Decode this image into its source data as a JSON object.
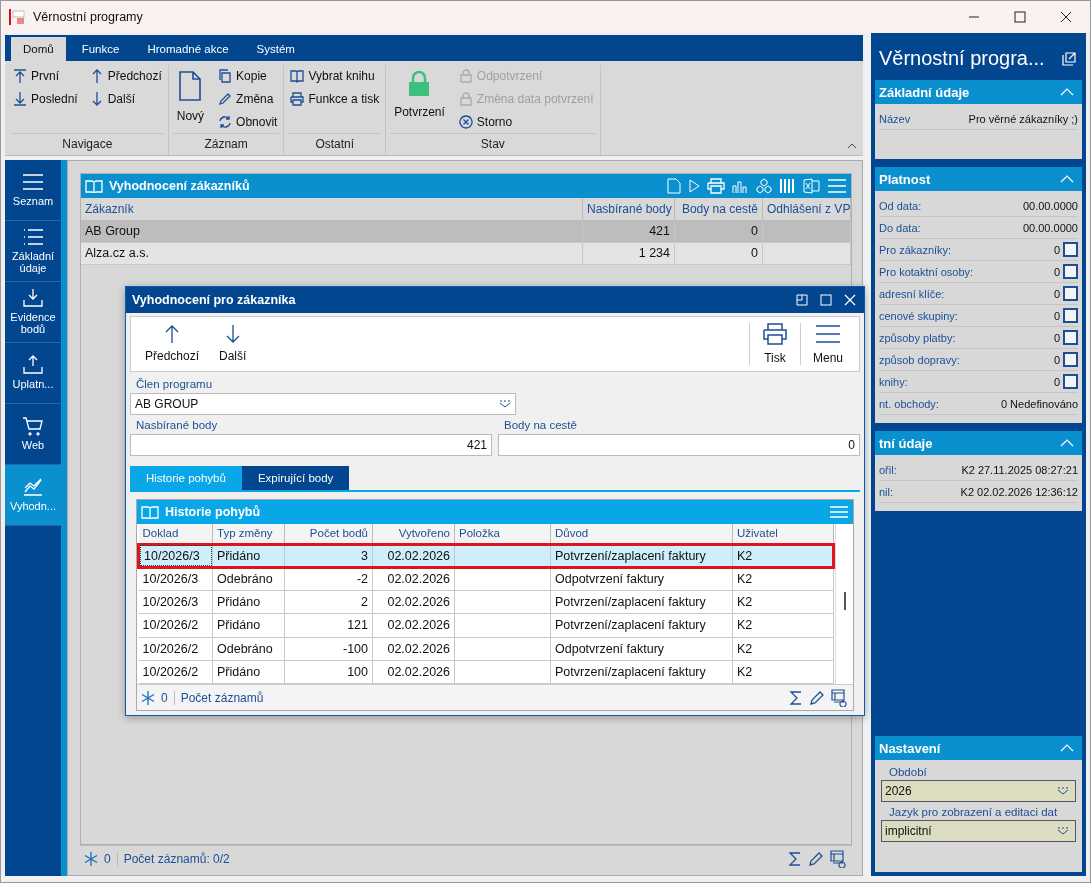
{
  "window": {
    "title": "Věrnostní programy"
  },
  "ribbon": {
    "tabs": [
      {
        "label": "Domů",
        "selected": true
      },
      {
        "label": "Funkce",
        "selected": false
      },
      {
        "label": "Hromadné akce",
        "selected": false
      },
      {
        "label": "Systém",
        "selected": false
      }
    ],
    "groups": [
      {
        "label": "Navigace",
        "columns": [
          [
            {
              "label": "První",
              "disabled": false
            },
            {
              "label": "Poslední",
              "disabled": false
            }
          ],
          [
            {
              "label": "Předchozí",
              "disabled": false
            },
            {
              "label": "Další",
              "disabled": false
            }
          ]
        ]
      },
      {
        "label": "Záznam",
        "large": {
          "label": "Nový",
          "disabled": false
        },
        "columns": [
          [
            {
              "label": "Kopie",
              "disabled": false
            },
            {
              "label": "Změna",
              "disabled": false
            },
            {
              "label": "Obnovit",
              "disabled": false
            }
          ]
        ]
      },
      {
        "label": "Ostatní",
        "columns": [
          [
            {
              "label": "Vybrat knihu",
              "disabled": false
            },
            {
              "label": "Funkce a tisk",
              "disabled": false
            }
          ]
        ]
      },
      {
        "label": "Stav",
        "large": {
          "label": "Potvrzení",
          "disabled": false
        },
        "columns": [
          [
            {
              "label": "Odpotvrzení",
              "disabled": true
            },
            {
              "label": "Změna data potvrzení",
              "disabled": true
            },
            {
              "label": "Storno",
              "disabled": false
            }
          ]
        ]
      }
    ]
  },
  "sidebar": {
    "items": [
      {
        "label": "Seznam",
        "selected": false
      },
      {
        "label": "Základní údaje",
        "selected": false
      },
      {
        "label": "Evidence bodů",
        "selected": false
      },
      {
        "label": "Uplatn...",
        "selected": false
      },
      {
        "label": "Web",
        "selected": false
      },
      {
        "label": "Vyhodn...",
        "selected": true
      }
    ]
  },
  "main_table": {
    "title": "Vyhodnocení zákazníků",
    "columns": [
      "Zákazník",
      "Nasbírané body",
      "Body na cestě",
      "Odhlášení z VP"
    ],
    "rows": [
      {
        "cells": [
          "AB Group",
          "421",
          "0",
          ""
        ],
        "selected": true
      },
      {
        "cells": [
          "Alza.cz a.s.",
          "1 234",
          "0",
          ""
        ],
        "selected": false
      }
    ],
    "footer": {
      "count": "0",
      "records": "Počet záznamů: 0/2"
    }
  },
  "dialog": {
    "title": "Vyhodnocení pro zákazníka",
    "toolbar_left": [
      "Předchozí",
      "Další"
    ],
    "toolbar_right": [
      "Tisk",
      "Menu"
    ],
    "member": {
      "label": "Člen programu",
      "value": "AB GROUP"
    },
    "collected": {
      "label": "Nasbírané body",
      "value": "421"
    },
    "pending": {
      "label": "Body na cestě",
      "value": "0"
    },
    "tabs": [
      {
        "label": "Historie pohybů",
        "selected": true
      },
      {
        "label": "Expirující body",
        "selected": false
      }
    ],
    "table": {
      "title": "Historie pohybů",
      "columns": [
        "Doklad",
        "Typ změny",
        "Počet bodů",
        "Vytvořeno",
        "Položka",
        "Důvod",
        "Uživatel"
      ],
      "rows": [
        {
          "cells": [
            "10/2026/3",
            "Přidáno",
            "3",
            "02.02.2026",
            "",
            "Potvrzení/zaplacení faktury",
            "K2"
          ],
          "selected": true,
          "highlighted": true
        },
        {
          "cells": [
            "10/2026/3",
            "Odebráno",
            "-2",
            "02.02.2026",
            "",
            "Odpotvrzení faktury",
            "K2"
          ],
          "selected": false,
          "highlighted": false
        },
        {
          "cells": [
            "10/2026/3",
            "Přidáno",
            "2",
            "02.02.2026",
            "",
            "Potvrzení/zaplacení faktury",
            "K2"
          ],
          "selected": false,
          "highlighted": false
        },
        {
          "cells": [
            "10/2026/2",
            "Přidáno",
            "121",
            "02.02.2026",
            "",
            "Potvrzení/zaplacení faktury",
            "K2"
          ],
          "selected": false,
          "highlighted": false
        },
        {
          "cells": [
            "10/2026/2",
            "Odebráno",
            "-100",
            "02.02.2026",
            "",
            "Odpotvrzení faktury",
            "K2"
          ],
          "selected": false,
          "highlighted": false
        },
        {
          "cells": [
            "10/2026/2",
            "Přidáno",
            "100",
            "02.02.2026",
            "",
            "Potvrzení/zaplacení faktury",
            "K2"
          ],
          "selected": false,
          "highlighted": false
        }
      ],
      "footer": {
        "count": "0",
        "records": "Počet záznamů"
      }
    }
  },
  "panel": {
    "title": "Věrnostní progra...",
    "sections": [
      {
        "title": "Základní údaje",
        "expanded": true,
        "rows": [
          {
            "kind": "text",
            "label": "Název",
            "value": "Pro věrné zákazníky ;)"
          }
        ]
      },
      {
        "title": "Platnost",
        "expanded": true,
        "rows": [
          {
            "kind": "text",
            "label": "Od data:",
            "value": "00.00.0000"
          },
          {
            "kind": "text",
            "label": "Do data:",
            "value": "00.00.0000"
          },
          {
            "kind": "checkbox",
            "label": "Pro zákazníky:",
            "value": "0",
            "checked": false
          },
          {
            "kind": "checkbox",
            "label": "Pro kotaktní osoby:",
            "value": "0",
            "checked": false
          },
          {
            "kind": "checkbox",
            "label": "adresní klíče:",
            "value": "0",
            "checked": false
          },
          {
            "kind": "checkbox",
            "label": "cenové skupiny:",
            "value": "0",
            "checked": false
          },
          {
            "kind": "checkbox",
            "label": "způsoby platby:",
            "value": "0",
            "checked": false
          },
          {
            "kind": "checkbox",
            "label": "způsob dopravy:",
            "value": "0",
            "checked": false
          },
          {
            "kind": "checkbox",
            "label": "knihy:",
            "value": "0",
            "checked": false
          },
          {
            "kind": "text",
            "label": "nt. obchody:",
            "value": "0 Nedefinováno"
          }
        ]
      },
      {
        "title": "tní údaje",
        "expanded": true,
        "rows": [
          {
            "kind": "text",
            "label": "ořil:",
            "value": "K2 27.11.2025 08:27:21"
          },
          {
            "kind": "text",
            "label": "nil:",
            "value": "K2 02.02.2026 12:36:12"
          }
        ]
      }
    ],
    "settings": {
      "title": "Nastavení",
      "expanded": true,
      "fields": [
        {
          "label": "Období",
          "value": "2026"
        },
        {
          "label": "Jazyk pro zobrazení a editaci dat",
          "value": "implicitní"
        }
      ]
    }
  }
}
